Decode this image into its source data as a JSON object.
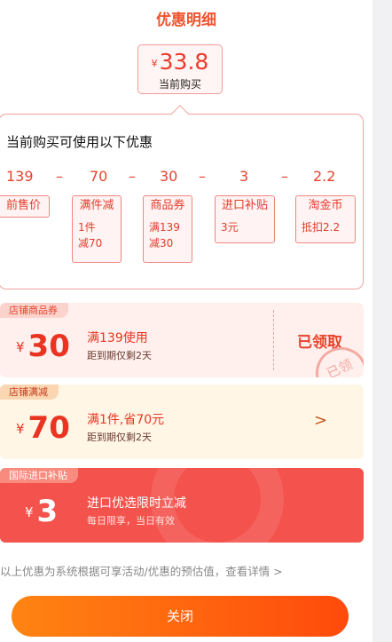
{
  "title": "优惠明细",
  "current": {
    "yen": "¥",
    "amount": "33.8",
    "label": "当前购买"
  },
  "calc": {
    "heading": "当前购买可使用以下优惠",
    "operator": "–",
    "numbers": [
      "139",
      "70",
      "30",
      "3",
      "2.2"
    ],
    "chips": [
      {
        "name": "前售价",
        "desc": []
      },
      {
        "name": "满件减",
        "desc": [
          "1件",
          "减70"
        ]
      },
      {
        "name": "商品券",
        "desc": [
          "满139",
          "减30"
        ]
      },
      {
        "name": "进口补贴",
        "desc": [
          "3元"
        ]
      },
      {
        "name": "淘金币",
        "desc": [
          "抵扣2.2"
        ]
      }
    ]
  },
  "coupons": [
    {
      "tag": "店铺商品券",
      "yen": "¥",
      "value": "30",
      "condition": "满139使用",
      "expiry": "距到期仅剩2天",
      "status": "已领取",
      "stamp": "已领"
    },
    {
      "tag": "店铺满减",
      "yen": "¥",
      "value": "70",
      "condition": "满1件,省70元",
      "expiry": "距到期仅剩2天",
      "chevron": ">"
    },
    {
      "tag": "国际进口补贴",
      "yen": "¥",
      "value": "3",
      "condition": "进口优选限时立减",
      "expiry": "每日限享，当日有效"
    }
  ],
  "note": "以上优惠为系统根据可享活动/优惠的预估值，查看详情 >",
  "close_label": "关闭",
  "colors": {
    "accent": "#e8432d",
    "button_start": "#ff8412",
    "button_end": "#ff4a0c",
    "subsidy_bg": "#f4524c"
  }
}
